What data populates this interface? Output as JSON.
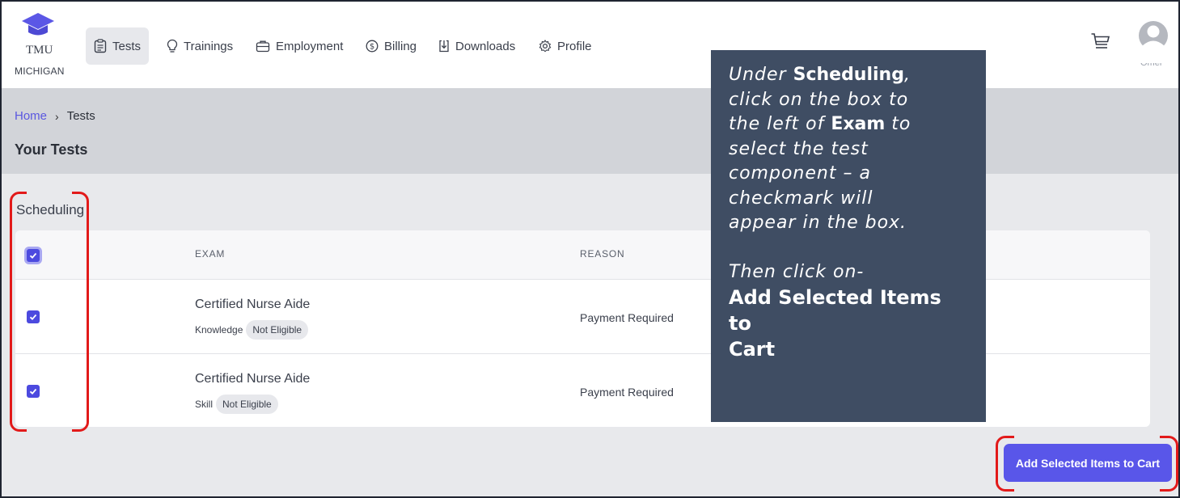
{
  "brand": {
    "name": "TMU",
    "subtitle": "MICHIGAN"
  },
  "nav": {
    "items": [
      {
        "label": "Tests",
        "icon": "clipboard-icon",
        "active": true
      },
      {
        "label": "Trainings",
        "icon": "lightbulb-icon",
        "active": false
      },
      {
        "label": "Employment",
        "icon": "briefcase-icon",
        "active": false
      },
      {
        "label": "Billing",
        "icon": "dollar-icon",
        "active": false
      },
      {
        "label": "Downloads",
        "icon": "download-icon",
        "active": false
      },
      {
        "label": "Profile",
        "icon": "gear-icon",
        "active": false
      }
    ],
    "cart_icon": "cart-icon",
    "avatar_icon": "user-avatar-icon",
    "username": "Omer"
  },
  "breadcrumb": {
    "home": "Home",
    "separator": "›",
    "current": "Tests"
  },
  "page_title": "Your Tests",
  "section": {
    "label": "Scheduling",
    "columns": {
      "exam": "EXAM",
      "reason": "REASON"
    },
    "rows": [
      {
        "exam": "Certified Nurse Aide",
        "component": "Knowledge",
        "status": "Not Eligible",
        "reason": "Payment Required",
        "checked": true
      },
      {
        "exam": "Certified Nurse Aide",
        "component": "Skill",
        "status": "Not Eligible",
        "reason": "Payment Required",
        "checked": true
      }
    ]
  },
  "callout": {
    "line_1_pre": "Under ",
    "line_1_bold": "Scheduling",
    "line_1_post": ",",
    "line_2": "click on the box to",
    "line_3_pre": "the left of ",
    "line_3_bold": "Exam",
    "line_3_post": " to",
    "line_4": "select the test",
    "line_5": "component – a",
    "line_6": "checkmark will",
    "line_7": "appear in the box.",
    "line_8": "Then click on-",
    "line_9": "Add Selected Items to",
    "line_10": "Cart"
  },
  "actions": {
    "add_to_cart": "Add Selected Items to Cart"
  },
  "colors": {
    "accent": "#5956e9",
    "annotation": "#e21a1a",
    "callout_bg": "#3f4d63"
  }
}
